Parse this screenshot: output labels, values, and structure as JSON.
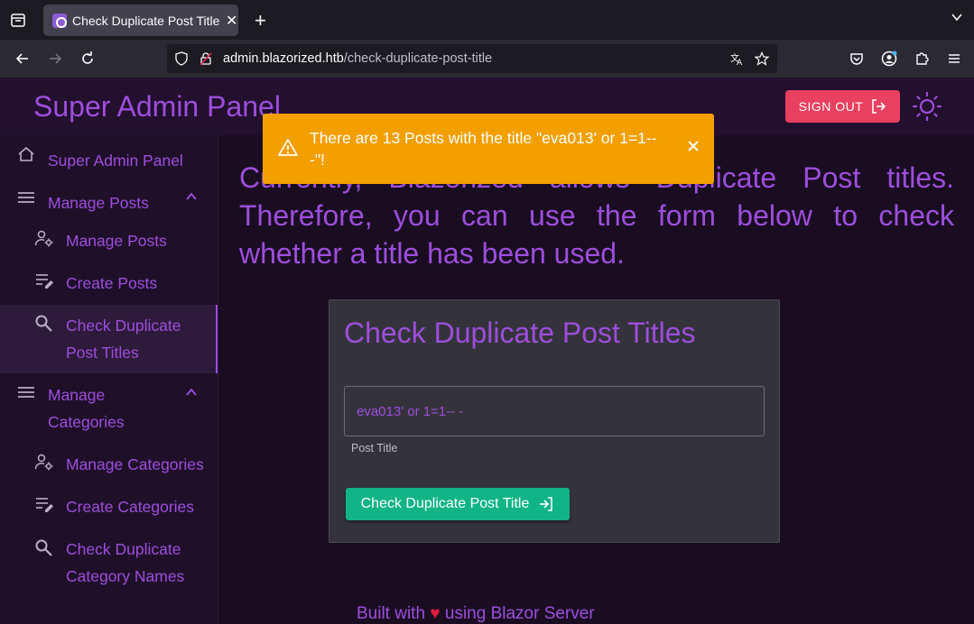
{
  "browser": {
    "tab_title": "Check Duplicate Post Title",
    "url_host": "admin.blazorized.htb",
    "url_path": "/check-duplicate-post-title"
  },
  "header": {
    "title": "Super Admin Panel",
    "signout_label": "SIGN OUT"
  },
  "sidebar": {
    "items": [
      {
        "label": "Super Admin Panel",
        "icon": "home-icon"
      },
      {
        "label": "Manage Posts",
        "icon": "menu-icon"
      },
      {
        "label": "Manage Posts",
        "icon": "user-gear-icon"
      },
      {
        "label": "Create Posts",
        "icon": "list-edit-icon"
      },
      {
        "label": "Check Duplicate Post Titles",
        "icon": "search-icon"
      },
      {
        "label": "Manage Categories",
        "icon": "menu-icon"
      },
      {
        "label": "Manage Categories",
        "icon": "user-gear-icon"
      },
      {
        "label": "Create Categories",
        "icon": "list-edit-icon"
      },
      {
        "label": "Check Duplicate Category Names",
        "icon": "search-icon"
      }
    ]
  },
  "main": {
    "intro": "Currently, Blazorized allows Duplicate Post titles. Therefore, you can use the form below to check whether a title has been used.",
    "card_title": "Check Duplicate Post Titles",
    "input_value": "eva013' or 1=1-- -",
    "input_helper": "Post Title",
    "button_label": "Check Duplicate Post Title",
    "footer_before": "Built with",
    "footer_after": "using Blazor Server"
  },
  "toast": {
    "message": "There are 13 Posts with the title \"eva013' or 1=1-- -\"!"
  },
  "colors": {
    "accent": "#9d4edd",
    "danger": "#e8405e",
    "success": "#11b486",
    "warning": "#f39f00"
  }
}
